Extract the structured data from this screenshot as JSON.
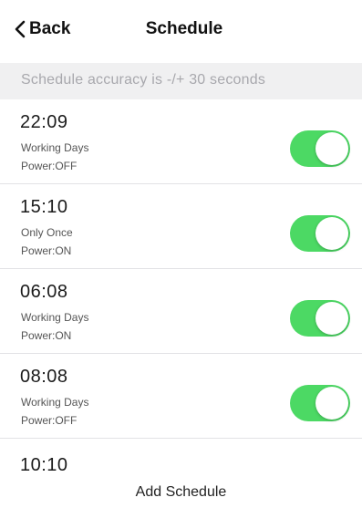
{
  "nav": {
    "back_label": "Back",
    "title": "Schedule"
  },
  "banner": {
    "text": "Schedule accuracy is -/+ 30 seconds"
  },
  "schedules": [
    {
      "time": "22:09",
      "repeat": "Working Days",
      "power": "Power:OFF",
      "enabled": true
    },
    {
      "time": "15:10",
      "repeat": "Only Once",
      "power": "Power:ON",
      "enabled": true
    },
    {
      "time": "06:08",
      "repeat": "Working Days",
      "power": "Power:ON",
      "enabled": true
    },
    {
      "time": "08:08",
      "repeat": "Working Days",
      "power": "Power:OFF",
      "enabled": true
    }
  ],
  "partial_schedule": {
    "time": "10:10"
  },
  "footer": {
    "add_label": "Add Schedule"
  },
  "colors": {
    "toggle_on": "#4cd964",
    "banner_bg": "#f0f0f1",
    "banner_text": "#a8a8ad"
  },
  "icons": {
    "back": "chevron-left-icon"
  }
}
